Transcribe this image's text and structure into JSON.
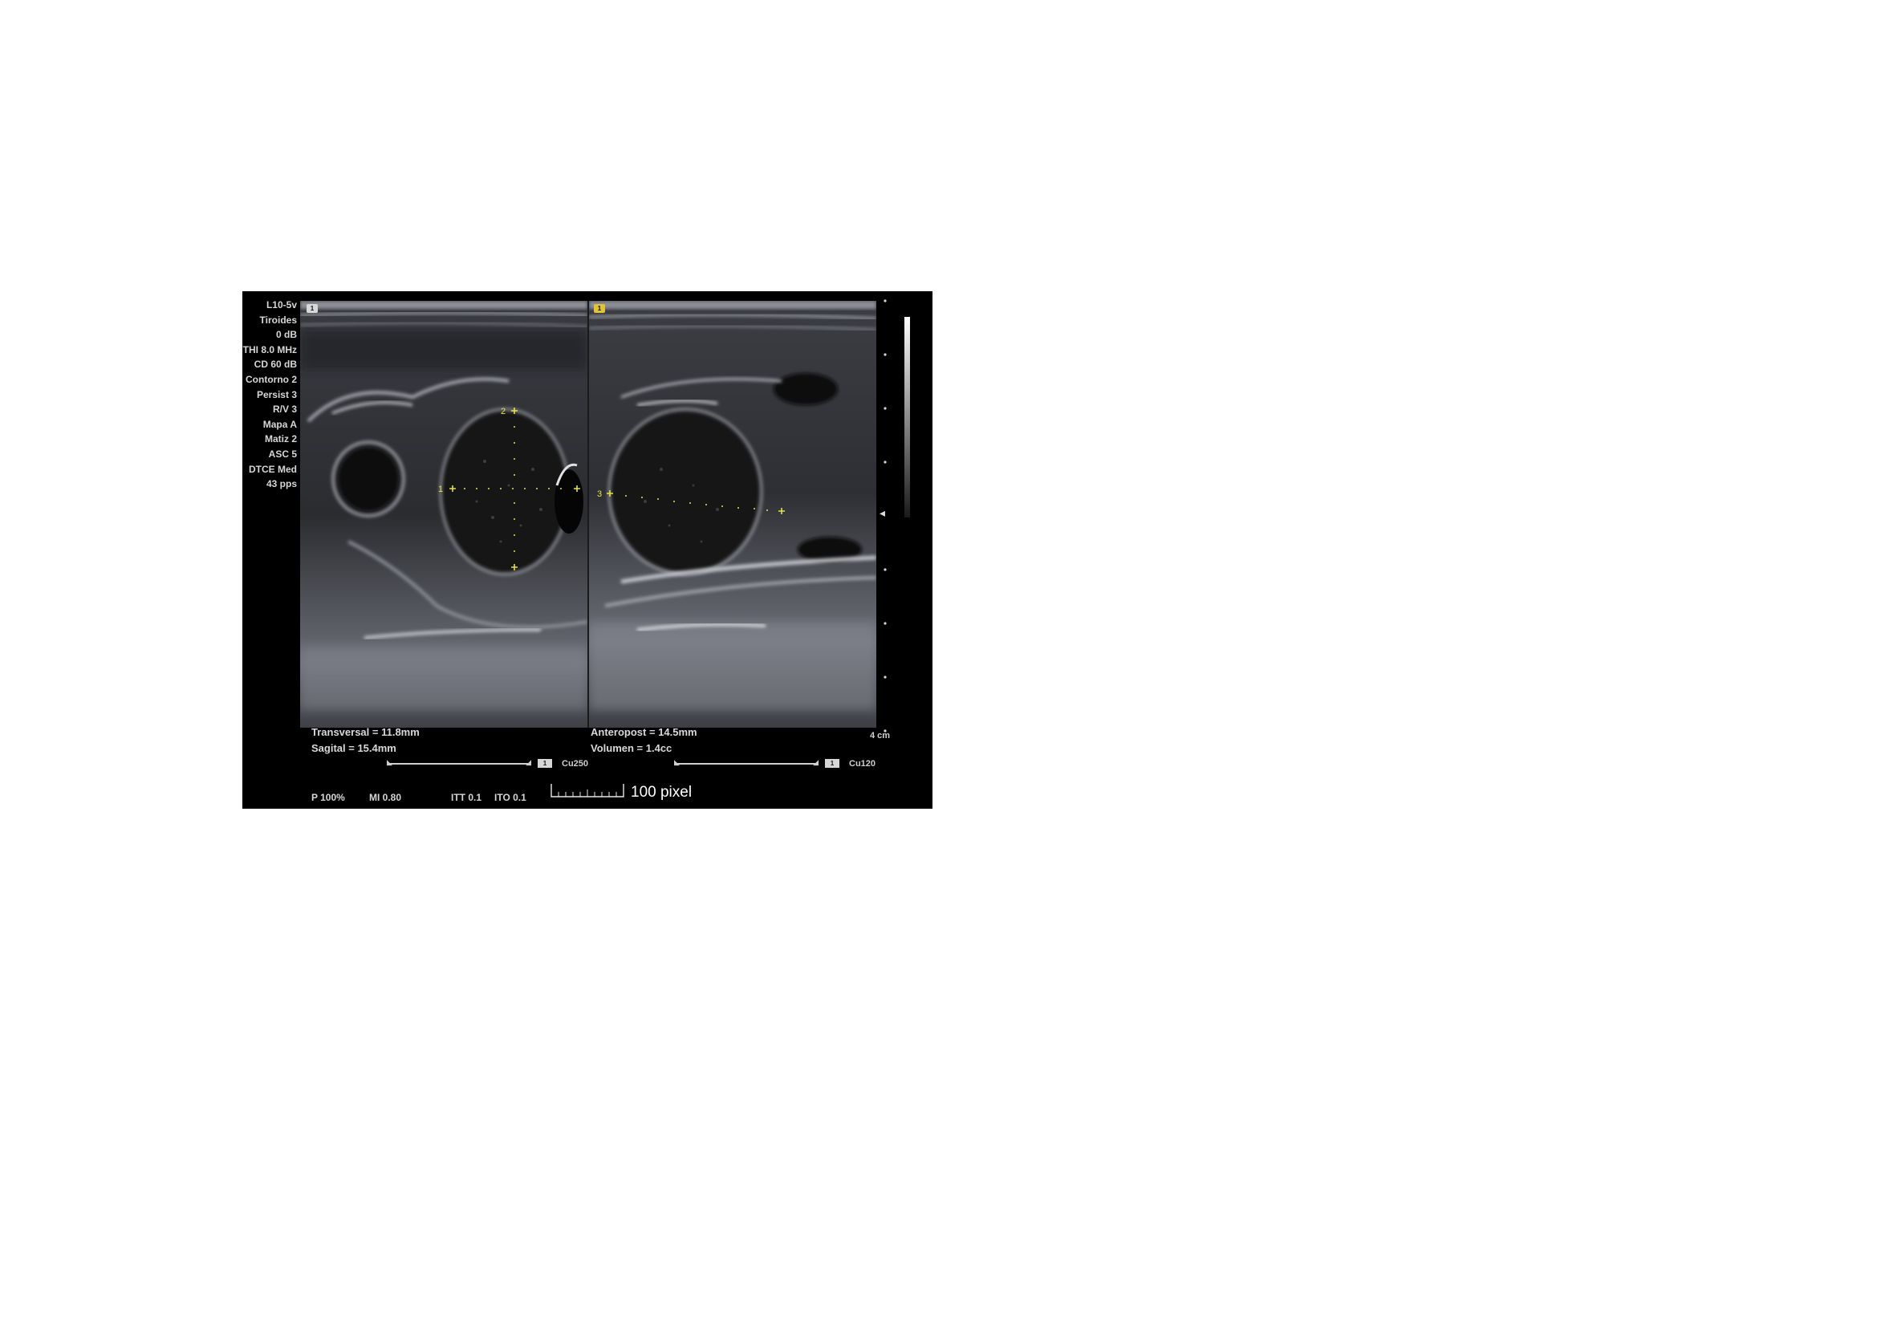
{
  "params": [
    "L10-5v",
    "Tiroides",
    "0 dB",
    "THI 8.0 MHz",
    "CD 60 dB",
    "Contorno 2",
    "Persist 3",
    "R/V 3",
    "Mapa A",
    "Matiz 2",
    "ASC 5",
    "DTCE Med",
    "43 pps"
  ],
  "left_pane": {
    "badge": "1",
    "measurements": [
      "Transversal = 11.8mm",
      "Sagital = 15.4mm"
    ],
    "caliper_labels": [
      "1",
      "2"
    ],
    "cine_box": "1",
    "cine_label": "Cu250"
  },
  "right_pane": {
    "badge": "1",
    "measurements": [
      "Anteropost = 14.5mm",
      "Volumen = 1.4cc"
    ],
    "caliper_labels": [
      "3"
    ],
    "cine_box": "1",
    "cine_label": "Cu120"
  },
  "depth_label": "4 cm",
  "footer": {
    "power": "P 100%",
    "mi": "MI 0.80",
    "itt": "ITT 0.1",
    "ito": "ITO 0.1"
  },
  "ruler_label": "100 pixel",
  "colors": {
    "caliper": "#e6e24a",
    "background": "#000000"
  }
}
